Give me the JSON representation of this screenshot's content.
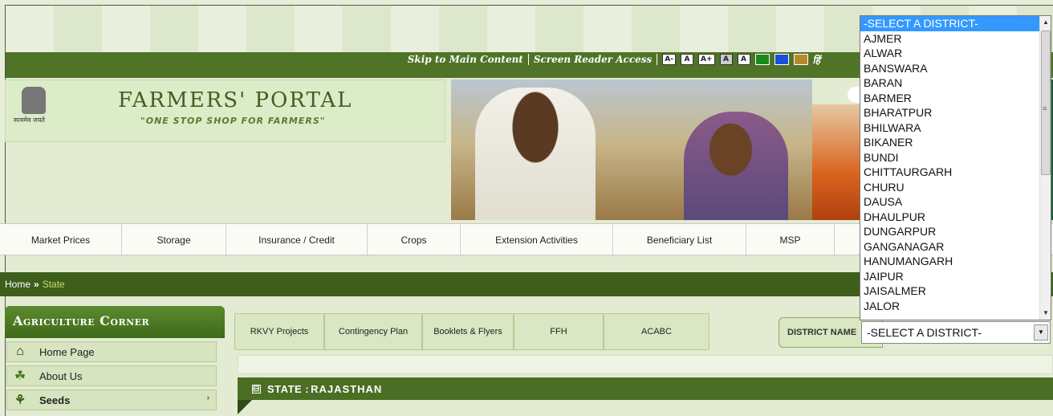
{
  "header": {
    "skip_link": "Skip to Main Content",
    "screen_reader": "Screen Reader Access",
    "font_buttons": [
      "A-",
      "A",
      "A+",
      "A",
      "A"
    ],
    "theme_colors": [
      "#1a8a1a",
      "#1a4fd6",
      "#b58a2a"
    ],
    "hindi_link": "हिं"
  },
  "logo": {
    "emblem_caption": "सत्यमेव जयते",
    "title": "FARMERS' PORTAL",
    "tagline": "\"ONE STOP SHOP FOR FARMERS\""
  },
  "main_nav": [
    {
      "label": "Market Prices"
    },
    {
      "label": "Storage"
    },
    {
      "label": "Insurance / Credit"
    },
    {
      "label": "Crops"
    },
    {
      "label": "Extension Activities"
    },
    {
      "label": "Beneficiary List"
    },
    {
      "label": "MSP"
    }
  ],
  "breadcrumb": {
    "home": "Home",
    "sep": "»",
    "current": "State"
  },
  "sidebar": {
    "title": "Agriculture Corner",
    "items": [
      {
        "label": "Home Page",
        "icon": "home-icon",
        "glyph": "⌂"
      },
      {
        "label": "About Us",
        "icon": "leaf-icon",
        "glyph": "☘"
      },
      {
        "label": "Seeds",
        "icon": "sprout-icon",
        "glyph": "⚘",
        "chevron": "›"
      }
    ]
  },
  "tabs": [
    "RKVY Projects",
    "Contingency Plan",
    "Booklets & Flyers",
    "FFH",
    "ACABC"
  ],
  "district": {
    "label": "DISTRICT NAME",
    "selected": "-SELECT A DISTRICT-",
    "options": [
      "-SELECT A DISTRICT-",
      "AJMER",
      "ALWAR",
      "BANSWARA",
      "BARAN",
      "BARMER",
      "BHARATPUR",
      "BHILWARA",
      "BIKANER",
      "BUNDI",
      "CHITTAURGARH",
      "CHURU",
      "DAUSA",
      "DHAULPUR",
      "DUNGARPUR",
      "GANGANAGAR",
      "HANUMANGARH",
      "JAIPUR",
      "JAISALMER",
      "JALOR"
    ]
  },
  "state": {
    "label": "STATE :",
    "value": "RAJASTHAN",
    "toggle": "⊟"
  }
}
